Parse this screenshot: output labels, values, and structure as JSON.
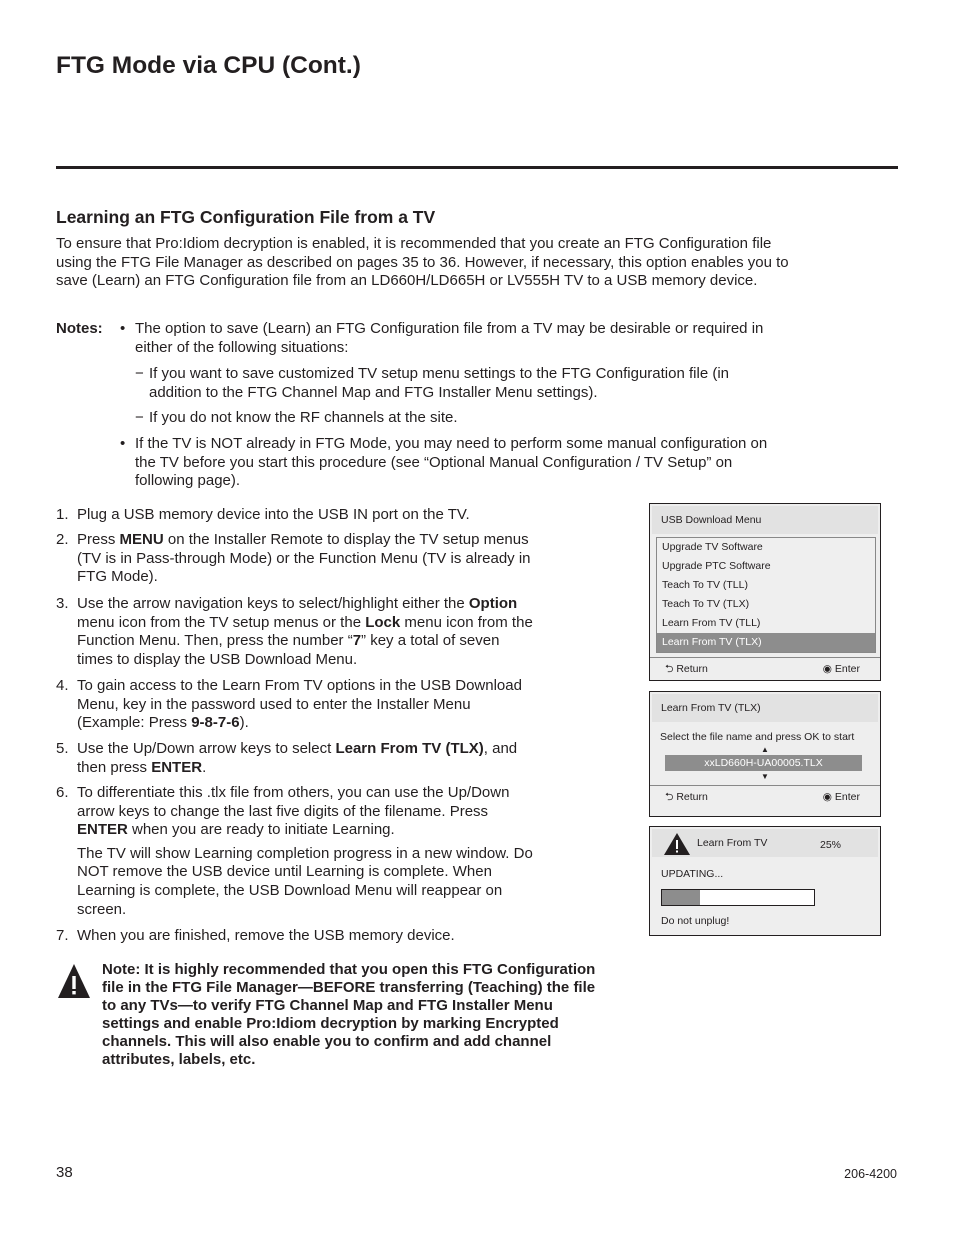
{
  "page": {
    "title": "FTG Mode via CPU (Cont.)",
    "section_title": "Learning an FTG Configuration File from a TV",
    "intro": "To ensure that Pro:Idiom decryption is enabled, it is recommended that you create an FTG Configuration file using the FTG File Manager as described on pages 35 to 36. However, if necessary, this option enables you to save (Learn) an FTG Configuration file from an LD660H/LD665H or LV555H TV to a USB memory device.",
    "notes_label": "Notes:",
    "notes": {
      "bullet1": "The option to save (Learn) an FTG Configuration file from a TV may be desirable or required in either of the following situations:",
      "dash1": "If you want to save customized TV setup menu settings to the FTG Configuration file (in addition to the FTG Channel Map and FTG Installer Menu settings).",
      "dash2": "If you do not know the RF channels at the site.",
      "bullet2": "If the TV is NOT already in FTG Mode, you may need to perform some manual configuration on the TV before you start this procedure (see “Optional Manual Configuration / TV Setup” on following page).",
      "bullet_char": "•",
      "dash_char": "−"
    },
    "steps": [
      {
        "n": "1.",
        "parts": [
          "Plug a USB memory device into the USB IN port on the TV."
        ]
      },
      {
        "n": "2.",
        "parts": [
          "Press ",
          "MENU",
          " on the Installer Remote to display the TV setup menus (TV is in Pass-through Mode) or the Function Menu (TV is already in FTG Mode)."
        ]
      },
      {
        "n": "3.",
        "parts": [
          "Use the arrow navigation keys to select/highlight either the ",
          "Option",
          " menu icon from the TV setup menus or the ",
          "Lock",
          " menu icon from the Function Menu. Then, press the number “",
          "7",
          "” key a total of seven times to display the USB Download Menu."
        ]
      },
      {
        "n": "4.",
        "parts": [
          "To gain access to the Learn From TV options in the USB Download Menu, key in the password used to enter the Installer Menu (Example: Press ",
          "9",
          "-",
          "8",
          "-",
          "7",
          "-",
          "6",
          ")."
        ]
      },
      {
        "n": "5.",
        "parts": [
          "Use the Up/Down arrow keys to select ",
          "Learn From TV (TLX)",
          ", and then press ",
          "ENTER",
          "."
        ]
      },
      {
        "n": "6.",
        "parts": [
          "To differentiate this .tlx file from others, you can use the Up/Down arrow keys to change the last five digits of the filename. Press ",
          "ENTER",
          " when you are ready to initiate Learning."
        ],
        "extra": "The TV will show Learning completion progress in a new window. Do NOT remove the USB device until Learning is complete. When Learning is complete, the USB Download Menu will reappear on screen."
      },
      {
        "n": "7.",
        "parts": [
          "When you are finished, remove the USB memory device."
        ]
      }
    ],
    "warning": "Note: It is highly recommended that you open this FTG Configuration file in the FTG File Manager—BEFORE transferring (Teaching) the file to any TVs—to verify FTG Channel Map and FTG Installer Menu settings and enable Pro:Idiom decryption by marking Encrypted channels. This will also enable you to confirm and add channel attributes, labels, etc.",
    "page_number": "38",
    "doc_number": "206-4200"
  },
  "usb_menu": {
    "title": "USB Download Menu",
    "items": [
      "Upgrade TV Software",
      "Upgrade PTC Software",
      "Teach To TV (TLL)",
      "Teach To TV (TLX)",
      "Learn From TV (TLL)",
      "Learn From TV (TLX)"
    ],
    "selected_index": 5,
    "return_label": "Return",
    "enter_label": "Enter"
  },
  "learn_panel": {
    "title": "Learn From TV (TLX)",
    "instruction": "Select the file name and press OK to start",
    "filename": "xxLD660H-UA00005.TLX",
    "up_arrow": "▲",
    "down_arrow": "▼",
    "return_label": "Return",
    "enter_label": "Enter"
  },
  "progress_panel": {
    "title": "Learn From TV",
    "percent_label": "25%",
    "progress": 0.25,
    "status": "UPDATING...",
    "warning": "Do not unplug!"
  },
  "colors": {
    "text": "#231f20",
    "panel_bg": "#eeeeee",
    "highlight": "#8d8d8d"
  }
}
